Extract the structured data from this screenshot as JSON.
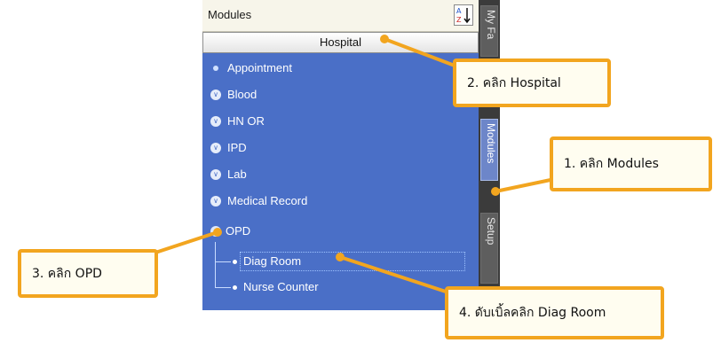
{
  "panel": {
    "title": "Modules",
    "sort_icon": "sort-az-icon",
    "active_tab": "Hospital"
  },
  "tree": {
    "items": [
      {
        "label": "Appointment",
        "icon": "bullet-icon"
      },
      {
        "label": "Blood",
        "icon": "expand-chevron-icon"
      },
      {
        "label": "HN OR",
        "icon": "expand-chevron-icon"
      },
      {
        "label": "IPD",
        "icon": "expand-chevron-icon"
      },
      {
        "label": "Lab",
        "icon": "expand-chevron-icon"
      },
      {
        "label": "Medical Record",
        "icon": "expand-chevron-icon"
      },
      {
        "label": "OPD",
        "icon": "collapse-icon"
      }
    ],
    "opd_children": [
      {
        "label": "Diag Room",
        "selected": true
      },
      {
        "label": "Nurse Counter",
        "selected": false
      }
    ]
  },
  "side_tabs": [
    "My Fa",
    "Modules",
    "Setup"
  ],
  "callouts": {
    "step1": "1. คลิก Modules",
    "step2": "2. คลิก Hospital",
    "step3": "3. คลิก OPD",
    "step4": "4. ดับเบิ้ลคลิก Diag Room"
  },
  "colors": {
    "tree_bg": "#4a6fc7",
    "callout_border": "#f2a51f",
    "arrow": "#f2a51f"
  }
}
